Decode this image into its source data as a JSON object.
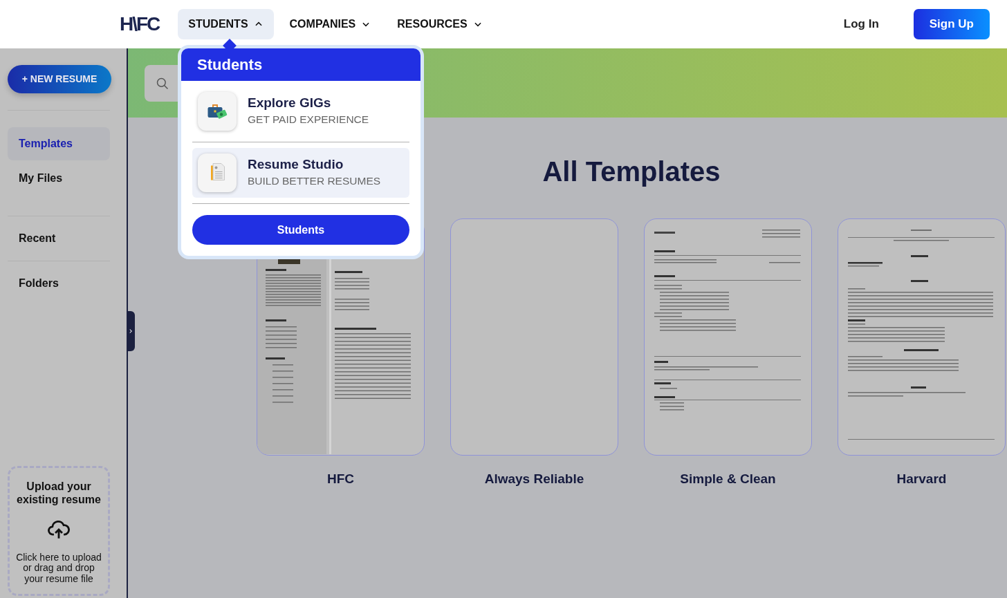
{
  "header": {
    "logo": "H\\FC",
    "nav": [
      {
        "label": "STUDENTS",
        "expanded": true
      },
      {
        "label": "COMPANIES",
        "expanded": false
      },
      {
        "label": "RESOURCES",
        "expanded": false
      }
    ],
    "login": "Log In",
    "signup": "Sign Up"
  },
  "dropdown": {
    "title": "Students",
    "items": [
      {
        "title": "Explore GIGs",
        "subtitle": "GET PAID EXPERIENCE",
        "kind": "gigs",
        "selected": false
      },
      {
        "title": "Resume Studio",
        "subtitle": "BUILD BETTER RESUMES",
        "kind": "resume",
        "selected": true
      }
    ],
    "button": "Students"
  },
  "sidebar": {
    "new_button": "+ NEW RESUME",
    "items": [
      {
        "label": "Templates",
        "selected": true
      },
      {
        "label": "My Files",
        "selected": false
      },
      {
        "label": "Recent",
        "selected": false
      },
      {
        "label": "Folders",
        "selected": false
      }
    ],
    "upload": {
      "title": "Upload your existing resume",
      "hint": "Click here to upload or drag and drop your resume file"
    }
  },
  "main": {
    "title": "All Templates",
    "templates": [
      {
        "name": "HFC",
        "kind": "two-column"
      },
      {
        "name": "Always Reliable",
        "kind": "blank"
      },
      {
        "name": "Simple & Clean",
        "kind": "left-aligned"
      },
      {
        "name": "Harvard",
        "kind": "centered"
      }
    ]
  }
}
